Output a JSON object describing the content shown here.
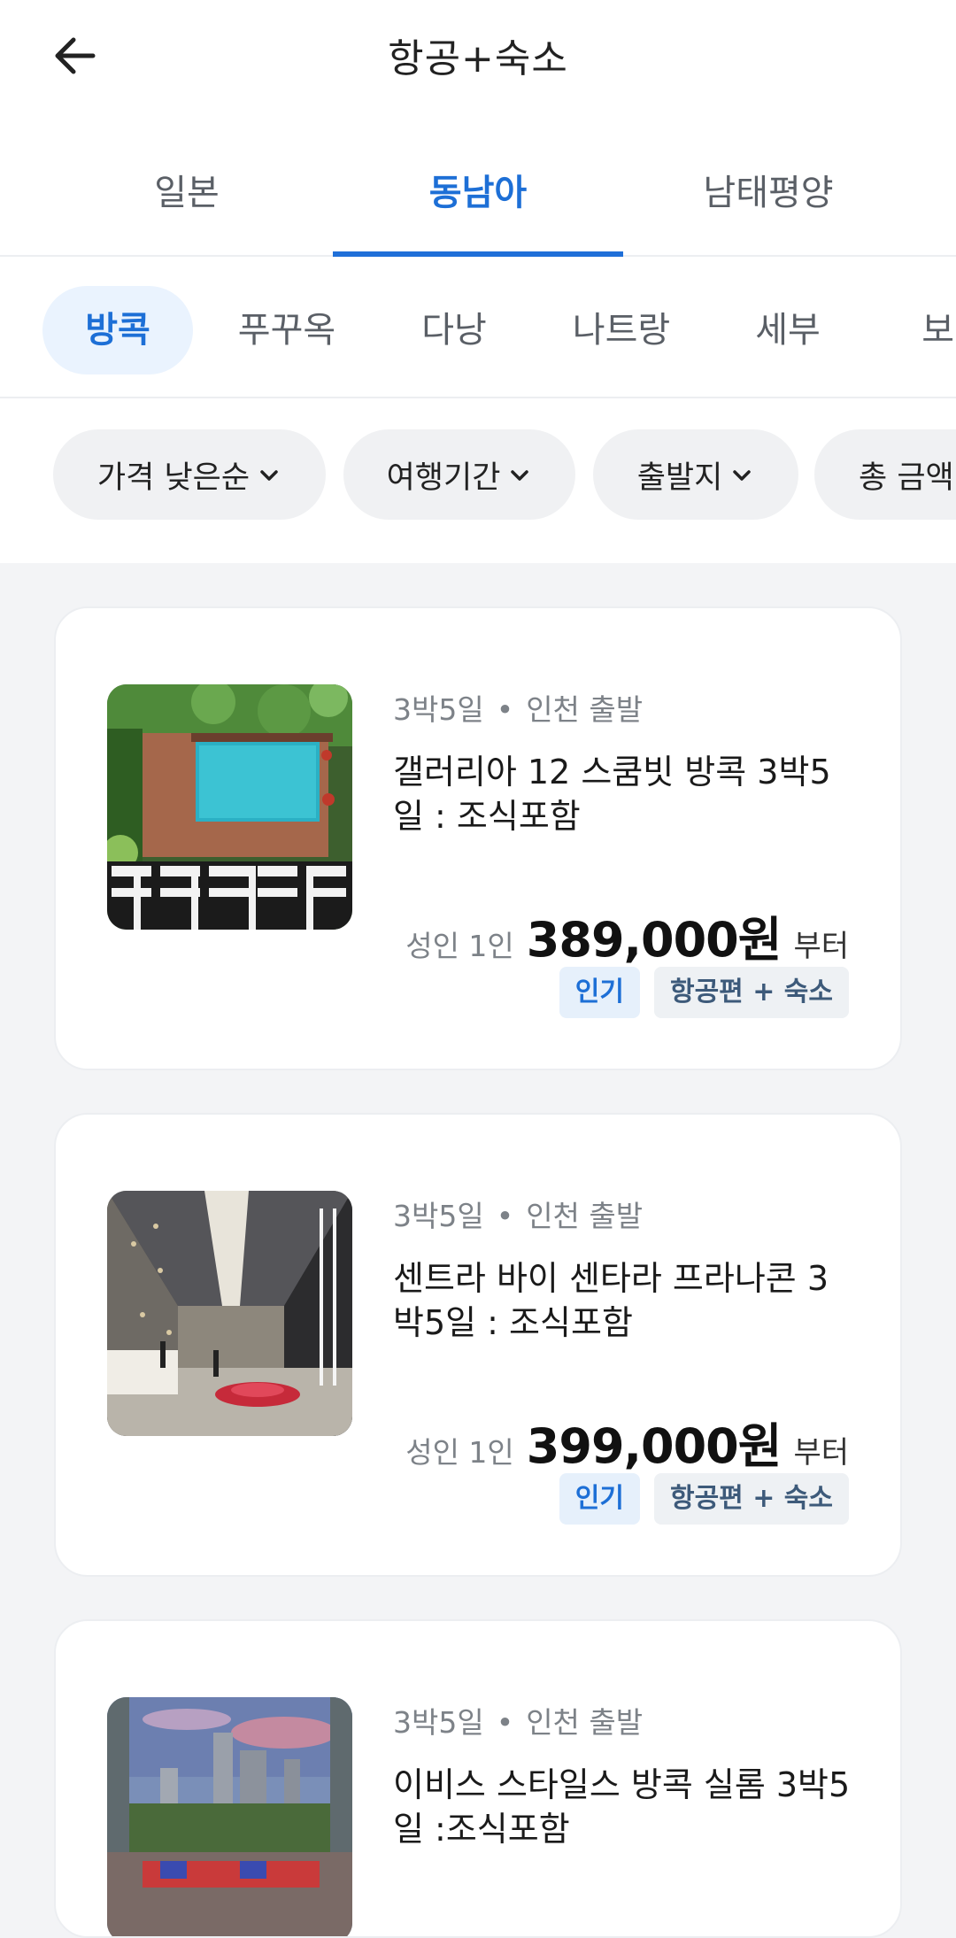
{
  "header": {
    "title": "항공+숙소"
  },
  "region_tabs": [
    {
      "label": "일본"
    },
    {
      "label": "동남아",
      "active": true
    },
    {
      "label": "남태평양"
    }
  ],
  "city_chips": [
    {
      "label": "방콕",
      "active": true
    },
    {
      "label": "푸꾸옥"
    },
    {
      "label": "다낭"
    },
    {
      "label": "나트랑"
    },
    {
      "label": "세부"
    },
    {
      "label": "보라"
    }
  ],
  "filters": [
    {
      "label": "가격 낮은순"
    },
    {
      "label": "여행기간"
    },
    {
      "label": "출발지"
    },
    {
      "label": "총 금액"
    }
  ],
  "products": [
    {
      "duration": "3박5일",
      "departure": "인천 출발",
      "title": "갤러리아 12 스쿰빗 방콕 3박5일 : 조식포함",
      "price_label": "성인 1인",
      "price": "389,000원",
      "price_suffix": "부터",
      "badges": [
        "인기",
        "항공편 + 숙소"
      ]
    },
    {
      "duration": "3박5일",
      "departure": "인천 출발",
      "title": "센트라 바이 센타라 프라나콘 3박5일 : 조식포함",
      "price_label": "성인 1인",
      "price": "399,000원",
      "price_suffix": "부터",
      "badges": [
        "인기",
        "항공편 + 숙소"
      ]
    },
    {
      "duration": "3박5일",
      "departure": "인천 출발",
      "title": "이비스 스타일스 방콕 실롬 3박5일 :조식포함"
    }
  ],
  "colors": {
    "accent": "#1d6fd6",
    "chip_active_bg": "#eaf3fe",
    "badge_popular_bg": "#e6f0fb"
  }
}
